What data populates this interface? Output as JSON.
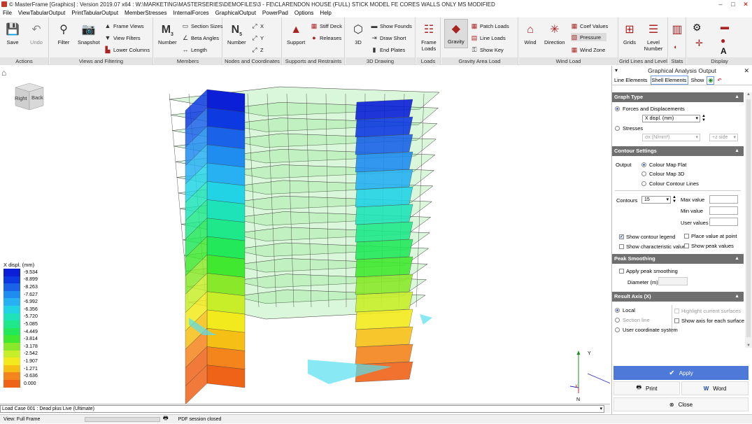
{
  "titlebar": {
    "title": "© MasterFrame [Graphics] : Version 2019.07 x64 : W:\\MARKETING\\MASTERSERIES\\DEMOFILES\\3 - FE\\CLARENDON HOUSE (FULL) STICK MODEL FE CORES WALLS ONLY MS MODIFIED"
  },
  "menu": [
    "File",
    "ViewTabularOutput",
    "PrintTabularOutput",
    "MemberStresses",
    "InternalForces",
    "GraphicalOutput",
    "PowerPad",
    "Options",
    "Help"
  ],
  "ribbon": {
    "groups": [
      {
        "title": "Actions"
      },
      {
        "title": "Views and Filtering"
      },
      {
        "title": "Members"
      },
      {
        "title": "Nodes and Coordinates"
      },
      {
        "title": "Supports and Restraints"
      },
      {
        "title": "3D Drawing"
      },
      {
        "title": "Loads"
      },
      {
        "title": "Gravity Area Load"
      },
      {
        "title": "Wind Load"
      },
      {
        "title": "Grid Lines and Levels"
      },
      {
        "title": "Stats"
      },
      {
        "title": "Display"
      }
    ],
    "save": "Save",
    "undo": "Undo",
    "filter": "Filter",
    "snapshot": "Snapshot",
    "frame_views": "Frame Views",
    "view_filters": "View Filters",
    "lower_columns": "Lower Columns",
    "member_number": "Number",
    "section_sizes": "Section Sizes",
    "beta_angles": "Beta Angles",
    "length": "Length",
    "node_number": "Number",
    "support": "Support",
    "stiff_deck": "Stiff Deck",
    "releases": "Releases",
    "threed": "3D",
    "show_founds": "Show Founds",
    "draw_short": "Draw Short",
    "end_plates": "End Plates",
    "frame_loads": "Frame Loads",
    "gravity": "Gravity",
    "patch_loads": "Patch Loads",
    "line_loads": "Line Loads",
    "show_key": "Show Key",
    "wind": "Wind",
    "direction": "Direction",
    "coef_values": "Coef Values",
    "pressure": "Pressure",
    "wind_zone": "Wind Zone",
    "grids": "Grids",
    "level_number": "Level Number"
  },
  "viewcube": {
    "left": "Right",
    "right": "Back"
  },
  "legend": {
    "title": "X displ. (mm)",
    "entries": [
      {
        "value": "-9.534",
        "color": "#0a1fd6"
      },
      {
        "value": "-8.899",
        "color": "#0d3ae0"
      },
      {
        "value": "-8.263",
        "color": "#1a63e8"
      },
      {
        "value": "-7.627",
        "color": "#1f8cf0"
      },
      {
        "value": "-6.992",
        "color": "#27b0f2"
      },
      {
        "value": "-6.356",
        "color": "#22d3e6"
      },
      {
        "value": "-5.720",
        "color": "#1fe3b8"
      },
      {
        "value": "-5.085",
        "color": "#1fe88a"
      },
      {
        "value": "-4.449",
        "color": "#22e85a"
      },
      {
        "value": "-3.814",
        "color": "#41e830"
      },
      {
        "value": "-3.178",
        "color": "#8ae82a"
      },
      {
        "value": "-2.542",
        "color": "#c8ee2a"
      },
      {
        "value": "-1.907",
        "color": "#f2ea1c"
      },
      {
        "value": "-1.271",
        "color": "#f6bf15"
      },
      {
        "value": "-0.636",
        "color": "#f4841c"
      },
      {
        "value": "0.000",
        "color": "#ef6318"
      }
    ]
  },
  "axes": {
    "y": "Y",
    "x": "X",
    "n": "N"
  },
  "statusbar": {
    "load_case": "Load Case 001 : Dead plus Live (Ultimate)"
  },
  "bottombar": {
    "view": "View: Full Frame",
    "pdf": "PDF session closed"
  },
  "panel": {
    "title": "Graphical Analysis Output",
    "tabs": [
      "Line Elements",
      "Shell Elements"
    ],
    "show_label": "Show",
    "graph_type": {
      "title": "Graph Type",
      "forces": "Forces and Displacements",
      "forces_combo": "X displ. (mm)",
      "stresses": "Stresses",
      "stresses_combo": "σx (N/mm²)",
      "side_combo": "+z side"
    },
    "contour": {
      "title": "Contour Settings",
      "output_label": "Output",
      "flat": "Colour Map Flat",
      "map3d": "Colour Map 3D",
      "lines": "Colour Contour Lines",
      "contours_label": "Contours",
      "contours_value": "15",
      "max": "Max value",
      "min": "Min value",
      "user": "User values",
      "show_legend": "Show contour legend",
      "place_value": "Place value at point",
      "show_char": "Show characteristic values",
      "show_peak": "Show peak values"
    },
    "peak": {
      "title": "Peak Smoothing",
      "apply": "Apply peak smoothing",
      "diameter": "Diameter (m)"
    },
    "result_axis": {
      "title": "Result Axis (X)",
      "local": "Local",
      "section_line": "Section line",
      "user_coord": "User coordinate system",
      "highlight": "Highlight current surfaces",
      "show_axis": "Show axis for each surface"
    },
    "apply": "Apply",
    "print": "Print",
    "word": "Word",
    "close": "Close"
  }
}
